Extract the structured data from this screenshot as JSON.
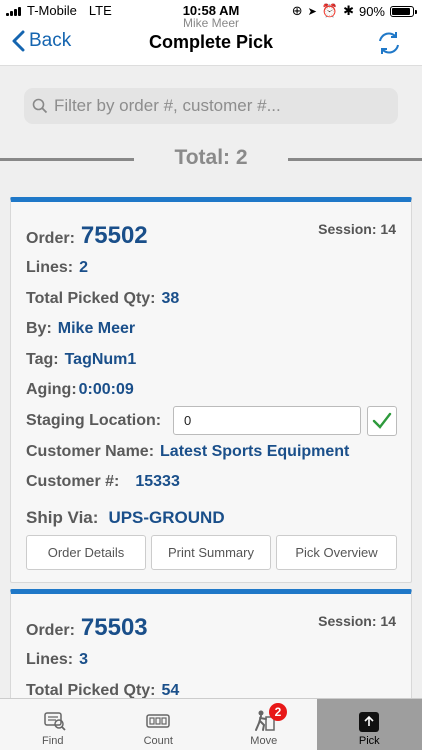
{
  "status_bar": {
    "carrier": "T-Mobile",
    "network": "LTE",
    "time": "10:58 AM",
    "battery": "90%",
    "battery_level": 0.9
  },
  "nav": {
    "back_label": "Back",
    "title": "Complete Pick",
    "subtitle": "Mike Meer"
  },
  "search": {
    "placeholder": "Filter by order #, customer #..."
  },
  "total": {
    "text": "Total: 2"
  },
  "labels": {
    "order": "Order:",
    "session": "Session:",
    "lines": "Lines:",
    "total_picked": "Total Picked Qty:",
    "by": "By:",
    "tag": "Tag:",
    "aging": "Aging:",
    "staging": "Staging Location:",
    "customer_name": "Customer Name:",
    "customer_num": "Customer #:",
    "ship_via": "Ship Via:"
  },
  "orders": [
    {
      "order": "75502",
      "session": "14",
      "lines": "2",
      "total_picked_qty": "38",
      "by": "Mike Meer",
      "tag": "TagNum1",
      "aging": "0:00:09",
      "staging_location": "0",
      "customer_name": "Latest Sports Equipment",
      "customer_num": "15333",
      "ship_via": "UPS-GROUND",
      "buttons": [
        "Order Details",
        "Print Summary",
        "Pick Overview"
      ]
    },
    {
      "order": "75503",
      "session": "14",
      "lines": "3",
      "total_picked_qty": "54"
    }
  ],
  "tabs": [
    {
      "label": "Find",
      "icon": "find-icon"
    },
    {
      "label": "Count",
      "icon": "count-icon"
    },
    {
      "label": "Move",
      "icon": "move-icon",
      "badge": "2"
    },
    {
      "label": "Pick",
      "icon": "pick-icon",
      "active": true
    }
  ],
  "colors": {
    "accent": "#1f78c8",
    "value_text": "#1a4f8a",
    "badge": "#e81818",
    "active_tab": "#9e9e9e"
  }
}
